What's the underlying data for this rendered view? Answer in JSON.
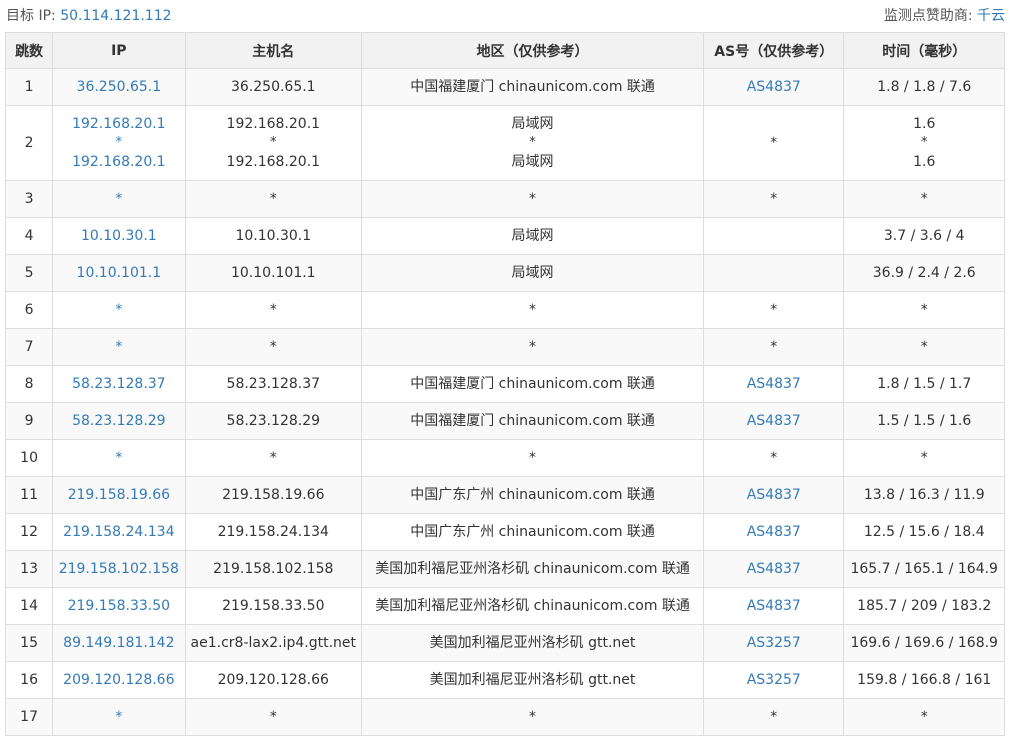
{
  "header": {
    "target_label": "目标 IP: ",
    "target_ip": "50.114.121.112",
    "sponsor_label": "监测点赞助商: ",
    "sponsor_name": "千云"
  },
  "columns": [
    "跳数",
    "IP",
    "主机名",
    "地区（仅供参考）",
    "AS号（仅供参考）",
    "时间（毫秒）"
  ],
  "rows": [
    {
      "hop": "1",
      "ips": [
        "36.250.65.1"
      ],
      "hosts": [
        "36.250.65.1"
      ],
      "regions": [
        "中国福建厦门 chinaunicom.com 联通"
      ],
      "as": "AS4837",
      "times": [
        "1.8 / 1.8 / 7.6"
      ]
    },
    {
      "hop": "2",
      "ips": [
        "192.168.20.1",
        "*",
        "192.168.20.1"
      ],
      "hosts": [
        "192.168.20.1",
        "*",
        "192.168.20.1"
      ],
      "regions": [
        "局域网",
        "*",
        "局域网"
      ],
      "as": "*",
      "times": [
        "1.6",
        "*",
        "1.6"
      ]
    },
    {
      "hop": "3",
      "ips": [
        "*"
      ],
      "hosts": [
        "*"
      ],
      "regions": [
        "*"
      ],
      "as": "*",
      "times": [
        "*"
      ]
    },
    {
      "hop": "4",
      "ips": [
        "10.10.30.1"
      ],
      "hosts": [
        "10.10.30.1"
      ],
      "regions": [
        "局域网"
      ],
      "as": "",
      "times": [
        "3.7 / 3.6 / 4"
      ]
    },
    {
      "hop": "5",
      "ips": [
        "10.10.101.1"
      ],
      "hosts": [
        "10.10.101.1"
      ],
      "regions": [
        "局域网"
      ],
      "as": "",
      "times": [
        "36.9 / 2.4 / 2.6"
      ]
    },
    {
      "hop": "6",
      "ips": [
        "*"
      ],
      "hosts": [
        "*"
      ],
      "regions": [
        "*"
      ],
      "as": "*",
      "times": [
        "*"
      ]
    },
    {
      "hop": "7",
      "ips": [
        "*"
      ],
      "hosts": [
        "*"
      ],
      "regions": [
        "*"
      ],
      "as": "*",
      "times": [
        "*"
      ]
    },
    {
      "hop": "8",
      "ips": [
        "58.23.128.37"
      ],
      "hosts": [
        "58.23.128.37"
      ],
      "regions": [
        "中国福建厦门 chinaunicom.com 联通"
      ],
      "as": "AS4837",
      "times": [
        "1.8 / 1.5 / 1.7"
      ]
    },
    {
      "hop": "9",
      "ips": [
        "58.23.128.29"
      ],
      "hosts": [
        "58.23.128.29"
      ],
      "regions": [
        "中国福建厦门 chinaunicom.com 联通"
      ],
      "as": "AS4837",
      "times": [
        "1.5 / 1.5 / 1.6"
      ]
    },
    {
      "hop": "10",
      "ips": [
        "*"
      ],
      "hosts": [
        "*"
      ],
      "regions": [
        "*"
      ],
      "as": "*",
      "times": [
        "*"
      ]
    },
    {
      "hop": "11",
      "ips": [
        "219.158.19.66"
      ],
      "hosts": [
        "219.158.19.66"
      ],
      "regions": [
        "中国广东广州 chinaunicom.com 联通"
      ],
      "as": "AS4837",
      "times": [
        "13.8 / 16.3 / 11.9"
      ]
    },
    {
      "hop": "12",
      "ips": [
        "219.158.24.134"
      ],
      "hosts": [
        "219.158.24.134"
      ],
      "regions": [
        "中国广东广州 chinaunicom.com 联通"
      ],
      "as": "AS4837",
      "times": [
        "12.5 / 15.6 / 18.4"
      ]
    },
    {
      "hop": "13",
      "ips": [
        "219.158.102.158"
      ],
      "hosts": [
        "219.158.102.158"
      ],
      "regions": [
        "美国加利福尼亚州洛杉矶 chinaunicom.com 联通"
      ],
      "as": "AS4837",
      "times": [
        "165.7 / 165.1 / 164.9"
      ]
    },
    {
      "hop": "14",
      "ips": [
        "219.158.33.50"
      ],
      "hosts": [
        "219.158.33.50"
      ],
      "regions": [
        "美国加利福尼亚州洛杉矶 chinaunicom.com 联通"
      ],
      "as": "AS4837",
      "times": [
        "185.7 / 209 / 183.2"
      ]
    },
    {
      "hop": "15",
      "ips": [
        "89.149.181.142"
      ],
      "hosts": [
        "ae1.cr8-lax2.ip4.gtt.net"
      ],
      "regions": [
        "美国加利福尼亚州洛杉矶 gtt.net"
      ],
      "as": "AS3257",
      "times": [
        "169.6 / 169.6 / 168.9"
      ]
    },
    {
      "hop": "16",
      "ips": [
        "209.120.128.66"
      ],
      "hosts": [
        "209.120.128.66"
      ],
      "regions": [
        "美国加利福尼亚州洛杉矶 gtt.net"
      ],
      "as": "AS3257",
      "times": [
        "159.8 / 166.8 / 161"
      ]
    },
    {
      "hop": "17",
      "ips": [
        "*"
      ],
      "hosts": [
        "*"
      ],
      "regions": [
        "*"
      ],
      "as": "*",
      "times": [
        "*"
      ]
    }
  ]
}
